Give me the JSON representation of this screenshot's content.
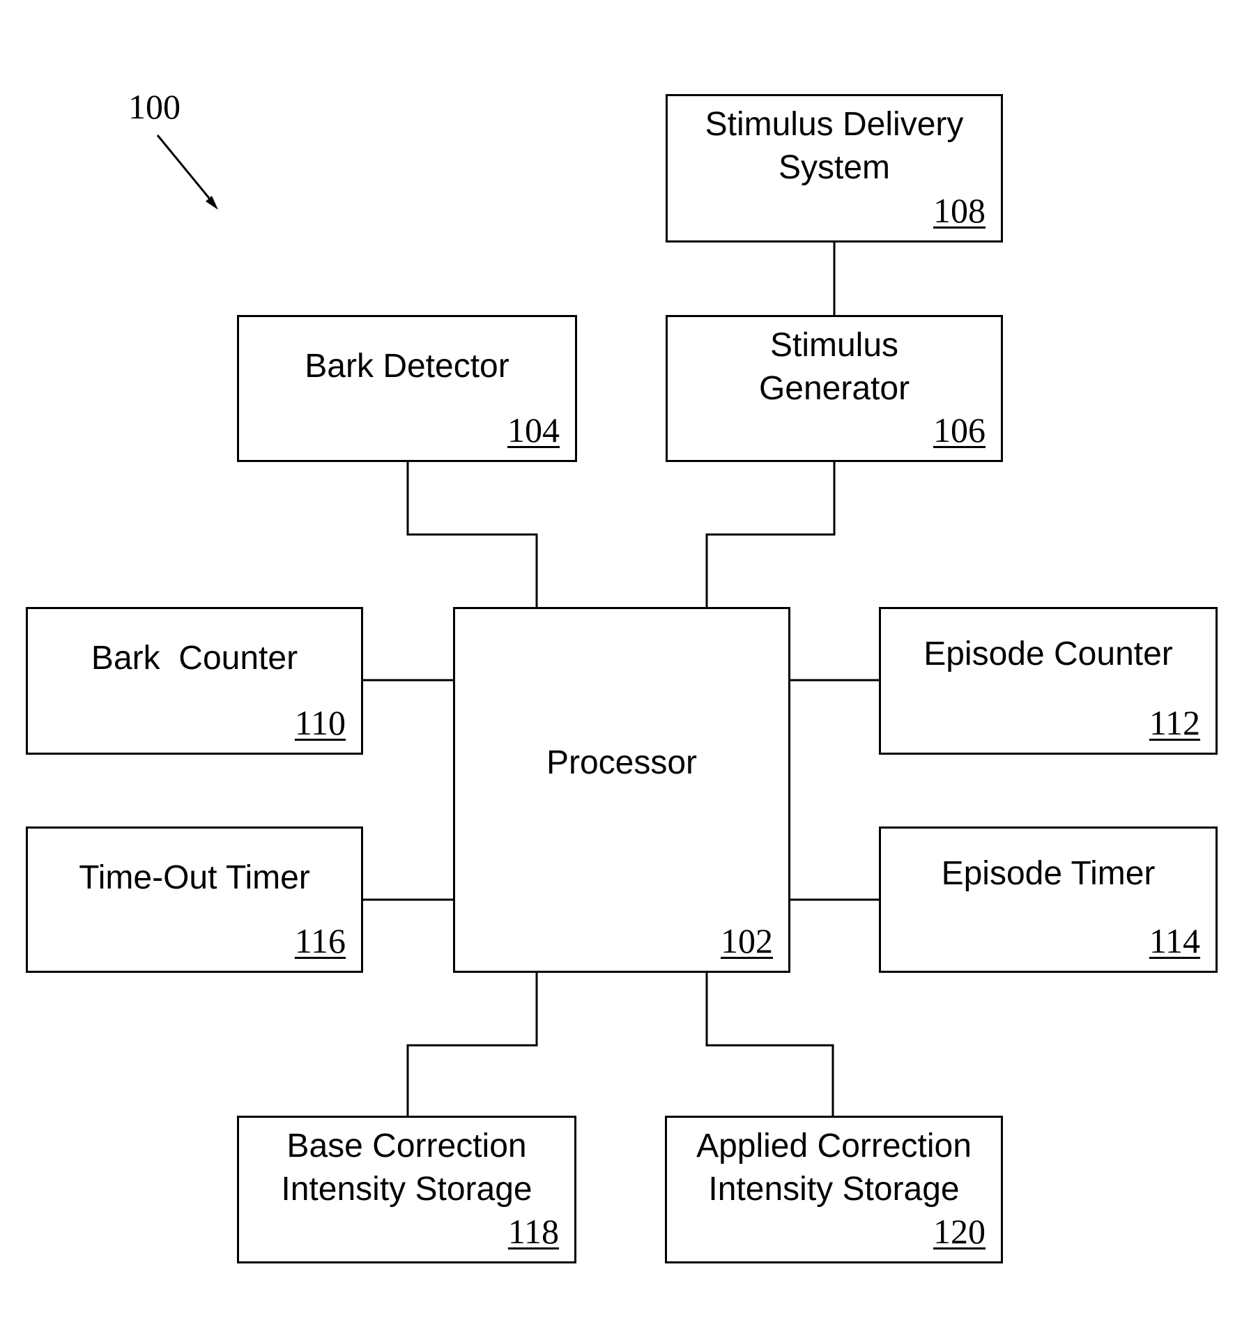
{
  "figure": {
    "reference": "100",
    "pointer_icon": "arrow-icon"
  },
  "blocks": {
    "processor": {
      "label": "Processor",
      "ref": "102"
    },
    "bark_detector": {
      "label": "Bark Detector",
      "ref": "104"
    },
    "stimulus_generator": {
      "label": "Stimulus\nGenerator",
      "ref": "106"
    },
    "stimulus_delivery": {
      "label": "Stimulus Delivery\nSystem",
      "ref": "108"
    },
    "bark_counter": {
      "label": "Bark  Counter",
      "ref": "110"
    },
    "episode_counter": {
      "label": "Episode Counter",
      "ref": "112"
    },
    "episode_timer": {
      "label": "Episode Timer",
      "ref": "114"
    },
    "timeout_timer": {
      "label": "Time-Out Timer",
      "ref": "116"
    },
    "base_storage": {
      "label": "Base Correction\nIntensity Storage",
      "ref": "118"
    },
    "applied_storage": {
      "label": "Applied Correction\nIntensity Storage",
      "ref": "120"
    }
  },
  "connections": [
    [
      "stimulus_delivery",
      "stimulus_generator"
    ],
    [
      "bark_detector",
      "processor"
    ],
    [
      "stimulus_generator",
      "processor"
    ],
    [
      "bark_counter",
      "processor"
    ],
    [
      "timeout_timer",
      "processor"
    ],
    [
      "episode_counter",
      "processor"
    ],
    [
      "episode_timer",
      "processor"
    ],
    [
      "processor",
      "base_storage"
    ],
    [
      "processor",
      "applied_storage"
    ]
  ]
}
